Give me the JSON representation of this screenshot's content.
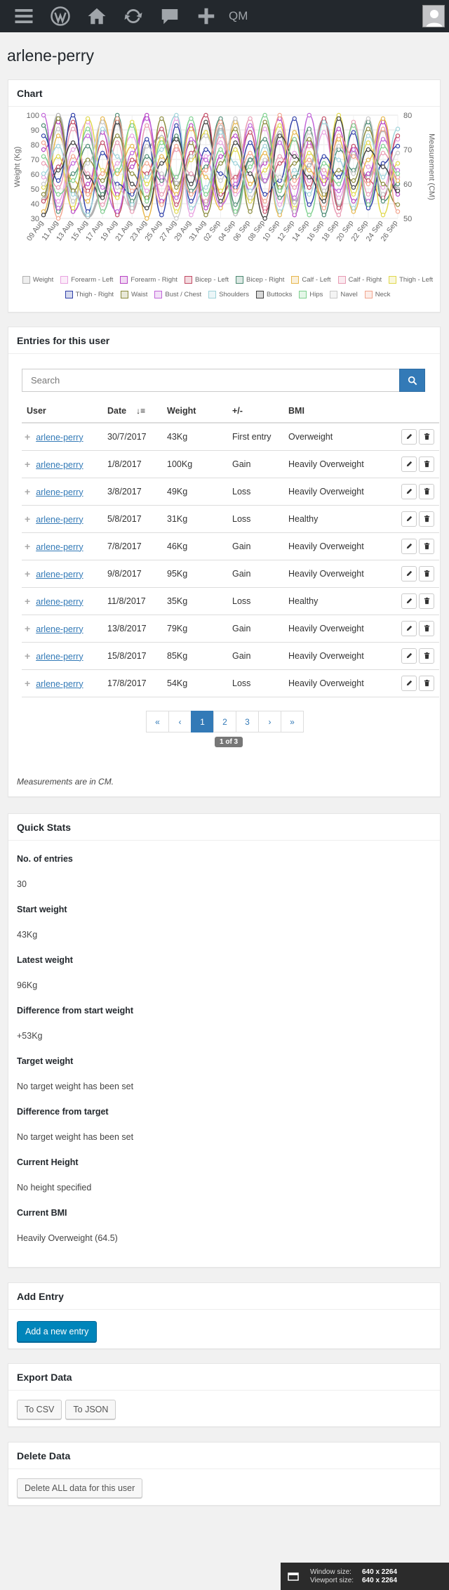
{
  "adminbar": {
    "qm_label": "QM"
  },
  "page_title": "arlene-perry",
  "chart_box": {
    "title": "Chart"
  },
  "chart_data": {
    "type": "line",
    "ylabel": "Weight (Kg)",
    "y2label": "Measurement (CM)",
    "ylim": [
      30,
      100
    ],
    "y2lim": [
      50,
      80
    ],
    "yticks": [
      30,
      40,
      50,
      60,
      70,
      80,
      90,
      100
    ],
    "y2ticks": [
      50,
      60,
      70,
      80
    ],
    "categories": [
      "09 Aug",
      "11 Aug",
      "13 Aug",
      "15 Aug",
      "17 Aug",
      "19 Aug",
      "21 Aug",
      "23 Aug",
      "25 Aug",
      "27 Aug",
      "29 Aug",
      "31 Aug",
      "02 Sep",
      "04 Sep",
      "06 Sep",
      "08 Sep",
      "10 Sep",
      "12 Sep",
      "14 Sep",
      "16 Sep",
      "18 Sep",
      "20 Sep",
      "22 Sep",
      "24 Sep",
      "26 Sep"
    ],
    "series": [
      {
        "name": "Weight",
        "color": "#b0b0b0",
        "values": [
          43,
          100,
          49,
          31,
          46,
          95,
          35,
          79,
          85,
          54,
          60,
          40,
          92,
          33,
          70,
          55,
          88,
          41,
          66,
          97,
          38,
          74,
          58,
          90,
          50
        ],
        "axis": "y"
      },
      {
        "name": "Forearm - Left",
        "color": "#e9a3e1",
        "values": [
          62,
          55,
          70,
          78,
          52,
          66,
          74,
          58,
          60,
          79,
          51,
          68,
          72,
          57,
          63,
          76,
          54,
          69,
          61,
          75,
          56,
          71,
          65,
          59,
          73
        ],
        "axis": "y2"
      },
      {
        "name": "Forearm - Right",
        "color": "#b844c4",
        "values": [
          70,
          78,
          52,
          60,
          75,
          57,
          65,
          80,
          55,
          62,
          77,
          53,
          68,
          74,
          58,
          66,
          79,
          51,
          72,
          60,
          76,
          55,
          63,
          78,
          57
        ],
        "axis": "y2"
      },
      {
        "name": "Bicep - Left",
        "color": "#c24b64",
        "values": [
          55,
          65,
          78,
          58,
          72,
          51,
          67,
          63,
          76,
          54,
          69,
          80,
          57,
          62,
          75,
          52,
          66,
          73,
          59,
          79,
          53,
          71,
          61,
          56,
          74
        ],
        "axis": "y2"
      },
      {
        "name": "Bicep - Right",
        "color": "#4d8a73",
        "values": [
          77,
          52,
          63,
          71,
          57,
          80,
          55,
          68,
          61,
          74,
          58,
          65,
          79,
          54,
          67,
          73,
          56,
          62,
          76,
          51,
          70,
          64,
          78,
          55,
          60
        ],
        "axis": "y2"
      },
      {
        "name": "Calf - Left",
        "color": "#e6b64c",
        "values": [
          52,
          74,
          61,
          55,
          79,
          63,
          71,
          50,
          68,
          57,
          76,
          62,
          53,
          78,
          60,
          69,
          51,
          75,
          64,
          56,
          73,
          52,
          67,
          79,
          61
        ],
        "axis": "y2"
      },
      {
        "name": "Calf - Right",
        "color": "#e89bb3",
        "values": [
          66,
          59,
          76,
          63,
          54,
          72,
          52,
          77,
          57,
          70,
          63,
          55,
          74,
          61,
          79,
          53,
          68,
          59,
          71,
          64,
          51,
          78,
          57,
          69,
          62
        ],
        "axis": "y2"
      },
      {
        "name": "Thigh - Left",
        "color": "#e0d84c",
        "values": [
          59,
          68,
          53,
          79,
          64,
          56,
          78,
          60,
          73,
          52,
          67,
          75,
          58,
          70,
          55,
          64,
          77,
          53,
          69,
          61,
          80,
          57,
          72,
          51,
          66
        ],
        "axis": "y2"
      },
      {
        "name": "Thigh - Right",
        "color": "#2f3fa8",
        "values": [
          74,
          61,
          80,
          52,
          69,
          60,
          57,
          73,
          51,
          77,
          55,
          70,
          63,
          59,
          72,
          57,
          61,
          79,
          54,
          68,
          62,
          75,
          53,
          66,
          71
        ],
        "axis": "y2"
      },
      {
        "name": "Waist",
        "color": "#8a8a3c",
        "values": [
          57,
          79,
          58,
          67,
          61,
          74,
          63,
          56,
          79,
          59,
          72,
          51,
          66,
          76,
          52,
          78,
          59,
          66,
          73,
          57,
          64,
          61,
          76,
          60,
          54
        ],
        "axis": "y2"
      },
      {
        "name": "Bust / Chest",
        "color": "#c065d8",
        "values": [
          80,
          53,
          66,
          74,
          59,
          52,
          69,
          79,
          62,
          56,
          73,
          67,
          54,
          60,
          77,
          61,
          72,
          56,
          80,
          62,
          58,
          70,
          55,
          73,
          64
        ],
        "axis": "y2"
      },
      {
        "name": "Shoulders",
        "color": "#9fd3da",
        "values": [
          63,
          71,
          57,
          51,
          76,
          68,
          54,
          62,
          70,
          80,
          53,
          59,
          75,
          66,
          58,
          71,
          52,
          64,
          57,
          78,
          67,
          53,
          74,
          62,
          76
        ],
        "axis": "y2"
      },
      {
        "name": "Buttocks",
        "color": "#404040",
        "values": [
          51,
          64,
          72,
          62,
          56,
          78,
          60,
          53,
          66,
          73,
          60,
          78,
          55,
          72,
          63,
          50,
          74,
          68,
          62,
          55,
          79,
          59,
          70,
          65,
          58
        ],
        "axis": "y2"
      },
      {
        "name": "Hips",
        "color": "#7ed08e",
        "values": [
          68,
          57,
          61,
          76,
          52,
          64,
          77,
          55,
          72,
          62,
          79,
          57,
          70,
          52,
          65,
          80,
          58,
          73,
          51,
          66,
          60,
          77,
          54,
          71,
          63
        ],
        "axis": "y2"
      },
      {
        "name": "Navel",
        "color": "#c8c8c8",
        "values": [
          60,
          76,
          55,
          66,
          78,
          59,
          53,
          71,
          63,
          50,
          68,
          74,
          61,
          79,
          56,
          67,
          62,
          52,
          75,
          58,
          71,
          63,
          79,
          57,
          69
        ],
        "axis": "y2"
      },
      {
        "name": "Neck",
        "color": "#f2a58e",
        "values": [
          72,
          50,
          68,
          57,
          63,
          79,
          58,
          66,
          54,
          71,
          57,
          64,
          78,
          58,
          69,
          55,
          80,
          61,
          67,
          53,
          74,
          68,
          60,
          76,
          52
        ],
        "axis": "y2"
      }
    ]
  },
  "entries_box": {
    "title": "Entries for this user",
    "search_placeholder": "Search",
    "columns": [
      "User",
      "Date",
      "Weight",
      "+/-",
      "BMI"
    ],
    "rows": [
      {
        "user": "arlene-perry",
        "date": "30/7/2017",
        "weight": "43Kg",
        "change": "First entry",
        "bmi": "Overweight"
      },
      {
        "user": "arlene-perry",
        "date": "1/8/2017",
        "weight": "100Kg",
        "change": "Gain",
        "bmi": "Heavily Overweight"
      },
      {
        "user": "arlene-perry",
        "date": "3/8/2017",
        "weight": "49Kg",
        "change": "Loss",
        "bmi": "Heavily Overweight"
      },
      {
        "user": "arlene-perry",
        "date": "5/8/2017",
        "weight": "31Kg",
        "change": "Loss",
        "bmi": "Healthy"
      },
      {
        "user": "arlene-perry",
        "date": "7/8/2017",
        "weight": "46Kg",
        "change": "Gain",
        "bmi": "Heavily Overweight"
      },
      {
        "user": "arlene-perry",
        "date": "9/8/2017",
        "weight": "95Kg",
        "change": "Gain",
        "bmi": "Heavily Overweight"
      },
      {
        "user": "arlene-perry",
        "date": "11/8/2017",
        "weight": "35Kg",
        "change": "Loss",
        "bmi": "Healthy"
      },
      {
        "user": "arlene-perry",
        "date": "13/8/2017",
        "weight": "79Kg",
        "change": "Gain",
        "bmi": "Heavily Overweight"
      },
      {
        "user": "arlene-perry",
        "date": "15/8/2017",
        "weight": "85Kg",
        "change": "Gain",
        "bmi": "Heavily Overweight"
      },
      {
        "user": "arlene-perry",
        "date": "17/8/2017",
        "weight": "54Kg",
        "change": "Loss",
        "bmi": "Heavily Overweight"
      }
    ],
    "pager": {
      "first": "«",
      "prev": "‹",
      "pages": [
        "1",
        "2",
        "3"
      ],
      "next": "›",
      "last": "»",
      "count": "1 of 3"
    },
    "note": "Measurements are in CM."
  },
  "stats_box": {
    "title": "Quick Stats",
    "items": [
      {
        "label": "No. of entries",
        "value": "30"
      },
      {
        "label": "Start weight",
        "value": "43Kg"
      },
      {
        "label": "Latest weight",
        "value": "96Kg"
      },
      {
        "label": "Difference from start weight",
        "value": "+53Kg"
      },
      {
        "label": "Target weight",
        "value": "No target weight has been set"
      },
      {
        "label": "Difference from target",
        "value": "No target weight has been set"
      },
      {
        "label": "Current Height",
        "value": "No height specified"
      },
      {
        "label": "Current BMI",
        "value": "Heavily Overweight (64.5)"
      }
    ]
  },
  "add_box": {
    "title": "Add Entry",
    "button": "Add a new entry"
  },
  "export_box": {
    "title": "Export Data",
    "csv": "To CSV",
    "json": "To JSON"
  },
  "delete_box": {
    "title": "Delete Data",
    "button": "Delete ALL data for this user"
  },
  "window_info": {
    "window_label": "Window size:",
    "window_value": "640 x 2264",
    "viewport_label": "Viewport size:",
    "viewport_value": "640 x 2264"
  }
}
